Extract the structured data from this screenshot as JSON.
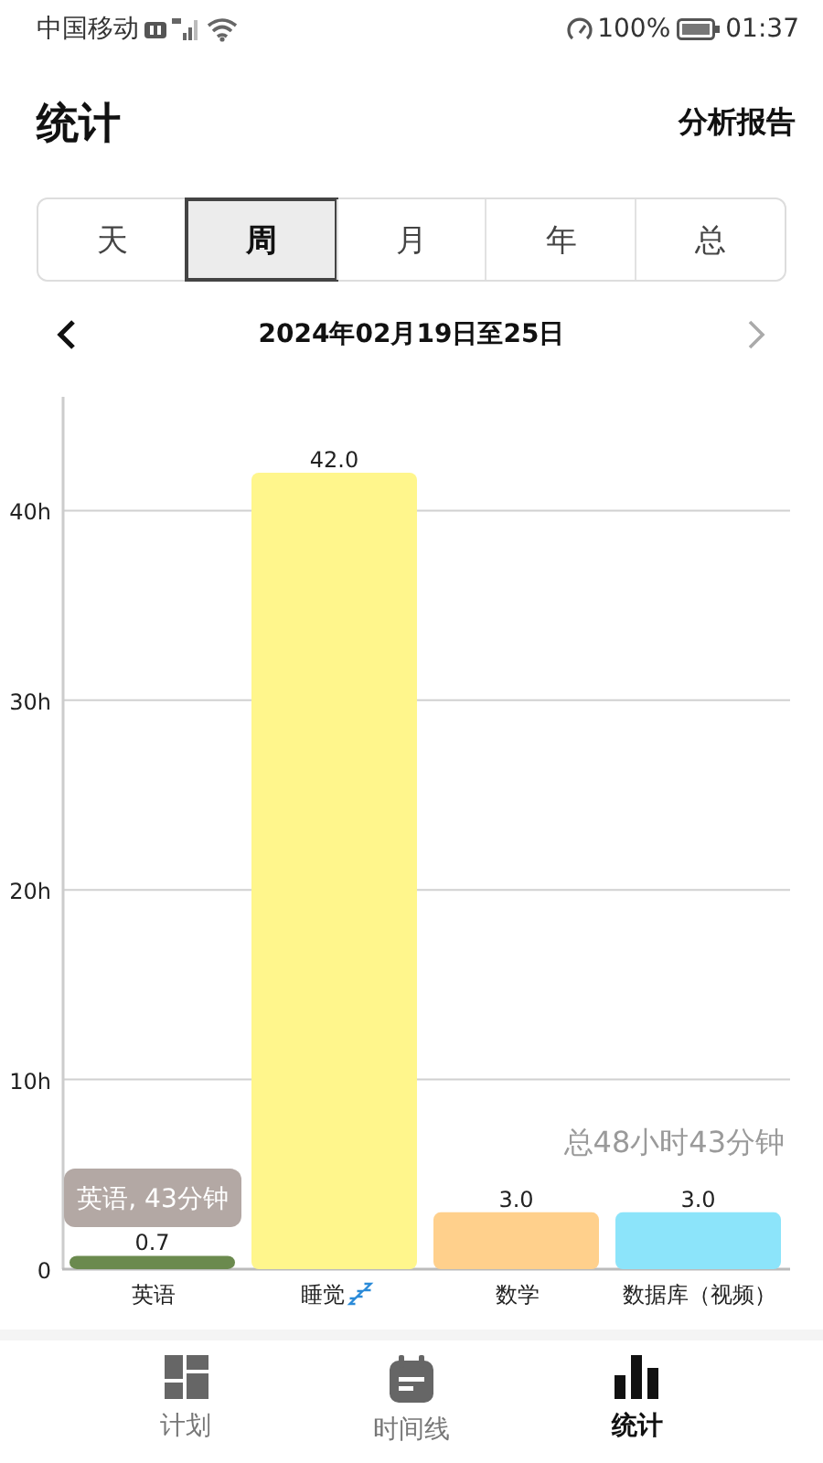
{
  "status_bar": {
    "carrier": "中国移动",
    "battery": "100%",
    "time": "01:37"
  },
  "header": {
    "title": "统计",
    "action": "分析报告"
  },
  "tabs": [
    {
      "label": "天",
      "selected": false
    },
    {
      "label": "周",
      "selected": true
    },
    {
      "label": "月",
      "selected": false
    },
    {
      "label": "年",
      "selected": false
    },
    {
      "label": "总",
      "selected": false
    }
  ],
  "date_nav": {
    "label": "2024年02月19日至25日",
    "prev_disabled": false,
    "next_disabled": true
  },
  "chart": {
    "tooltip": "英语, 43分钟",
    "total": "总48小时43分钟",
    "chart_data": {
      "type": "bar",
      "grid": true,
      "value_labels": [
        "0.7",
        "42.0",
        "3.0",
        "3.0"
      ],
      "categories": [
        "英语",
        "睡觉",
        "数学",
        "数据库（视频）"
      ],
      "ylim": [
        0,
        46
      ],
      "yticks": [
        {
          "value": 0,
          "label": "0"
        },
        {
          "value": 10,
          "label": "10h"
        },
        {
          "value": 20,
          "label": "20h"
        },
        {
          "value": 30,
          "label": "30h"
        },
        {
          "value": 40,
          "label": "40h"
        }
      ],
      "values": [
        0.7,
        42.0,
        3.0,
        3.0
      ],
      "colors": [
        "#6b8a4e",
        "#fff68c",
        "#ffd08c",
        "#8ce4fa"
      ]
    }
  },
  "bottom_nav": [
    {
      "kind": "grid",
      "label": "计划",
      "selected": false
    },
    {
      "kind": "calendar",
      "label": "时间线",
      "selected": false
    },
    {
      "kind": "chart",
      "label": "统计",
      "selected": true
    }
  ]
}
